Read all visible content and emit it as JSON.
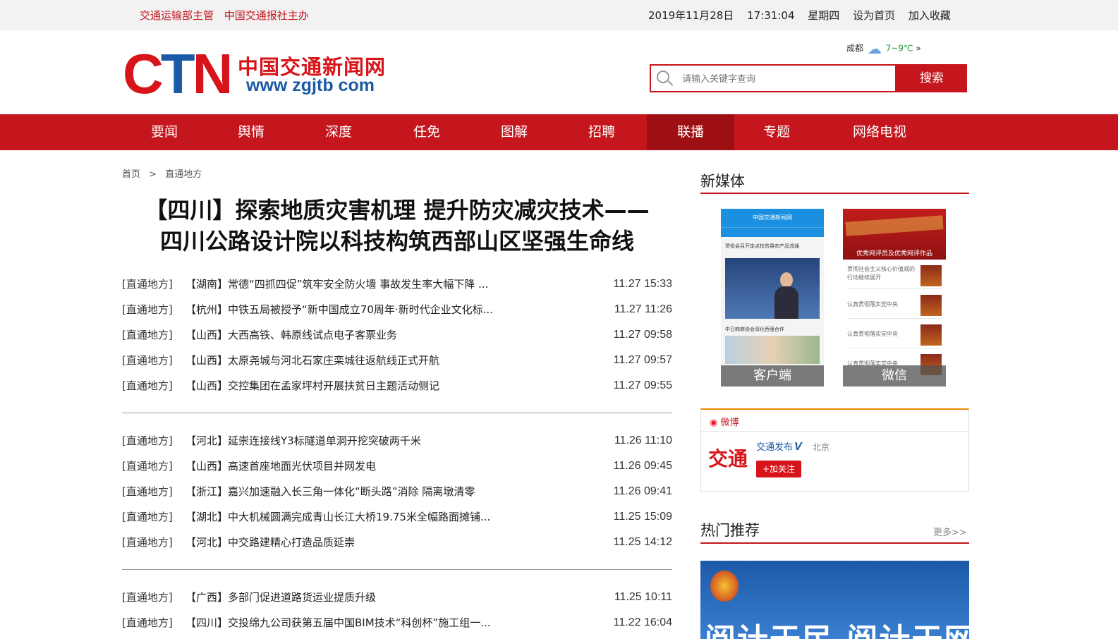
{
  "topbar": {
    "left1": "交通运输部主管",
    "left2": "中国交通报社主办",
    "date": "2019年11月28日",
    "time": "17:31:04",
    "weekday": "星期四",
    "set_home": "设为首页",
    "favorite": "加入收藏"
  },
  "logo": {
    "ctn": "CTN",
    "cn": "中国交通新闻网",
    "url": "www zgjtb com"
  },
  "weather": {
    "city": "成都",
    "temp": "7~9℃",
    "arrow": "»"
  },
  "search": {
    "placeholder": "请输入关键字查询",
    "button": "搜索"
  },
  "nav": [
    "要闻",
    "舆情",
    "深度",
    "任免",
    "图解",
    "招聘",
    "联播",
    "专题",
    "网络电视"
  ],
  "nav_active": "联播",
  "breadcrumb": {
    "home": "首页",
    "sep": ">",
    "current": "直通地方"
  },
  "article_title": {
    "line1": "【四川】探索地质灾害机理 提升防灾减灾技术——",
    "line2": "四川公路设计院以科技构筑西部山区坚强生命线"
  },
  "news_groups": [
    [
      {
        "cat": "[直通地方]",
        "text": "【湖南】常德“四抓四促”筑牢安全防火墙 事故发生率大幅下降 ...",
        "time": "11.27 15:33"
      },
      {
        "cat": "[直通地方]",
        "text": "【杭州】中铁五局被授予“新中国成立70周年·新时代企业文化标...",
        "time": "11.27 11:26"
      },
      {
        "cat": "[直通地方]",
        "text": "【山西】大西高铁、韩原线试点电子客票业务",
        "time": "11.27 09:58"
      },
      {
        "cat": "[直通地方]",
        "text": "【山西】太原尧城与河北石家庄栾城往返航线正式开航",
        "time": "11.27 09:57"
      },
      {
        "cat": "[直通地方]",
        "text": "【山西】交控集团在孟家坪村开展扶贫日主题活动侧记",
        "time": "11.27 09:55"
      }
    ],
    [
      {
        "cat": "[直通地方]",
        "text": "【河北】延崇连接线Y3标隧道单洞开挖突破两千米",
        "time": "11.26 11:10"
      },
      {
        "cat": "[直通地方]",
        "text": "【山西】高速首座地面光伏项目并网发电",
        "time": "11.26 09:45"
      },
      {
        "cat": "[直通地方]",
        "text": "【浙江】嘉兴加速融入长三角一体化“断头路”消除 隔离墩清零",
        "time": "11.26 09:41"
      },
      {
        "cat": "[直通地方]",
        "text": "【湖北】中大机械圆满完成青山长江大桥19.75米全幅路面摊铺...",
        "time": "11.25 15:09"
      },
      {
        "cat": "[直通地方]",
        "text": "【河北】中交路建精心打造品质延崇",
        "time": "11.25 14:12"
      }
    ],
    [
      {
        "cat": "[直通地方]",
        "text": "【广西】多部门促进道路货运业提质升级",
        "time": "11.25 10:11"
      },
      {
        "cat": "[直通地方]",
        "text": "【四川】交投绵九公司获第五届中国BIM技术“科创杯”施工组一...",
        "time": "11.22 16:04"
      }
    ]
  ],
  "sidebar": {
    "new_media": "新媒体",
    "phone1": {
      "header": "中国交通新闻网",
      "caption1": "贺役会召开定点扶贫县农产品流通",
      "caption2": "中日韩商协会深化西强合作",
      "label": "客户端"
    },
    "phone2": {
      "banner": "优秀网评员及优秀网评作品",
      "rows": [
        "贯彻社会主义核心价值观的行动继续展开",
        "认真贯彻落实党中央",
        "认真贯彻落实党中央",
        "认真贯彻落实党中央"
      ],
      "label": "微信"
    },
    "weibo": {
      "title": "微博",
      "avatar": "交通",
      "name": "交通发布",
      "v": "V",
      "location": "北京",
      "follow": "+加关注"
    },
    "hot": {
      "title": "热门推荐",
      "more": "更多>>",
      "banner": "阅计于民 阅计于网"
    }
  },
  "colors": {
    "brand_red": "#c4161c",
    "brand_blue": "#1b5aa6",
    "nav_active": "#9e0f14"
  }
}
